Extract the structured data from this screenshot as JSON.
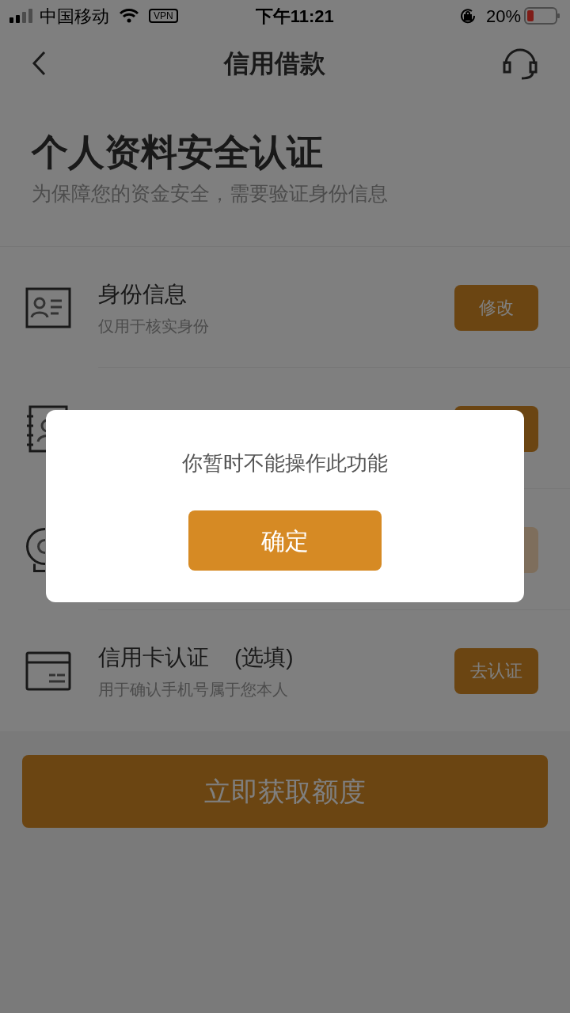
{
  "status_bar": {
    "carrier": "中国移动",
    "vpn": "VPN",
    "time": "下午11:21",
    "battery": "20%"
  },
  "nav": {
    "title": "信用借款"
  },
  "header": {
    "title": "个人资料安全认证",
    "subtitle": "为保障您的资金安全，需要验证身份信息"
  },
  "rows": [
    {
      "title": "身份信息",
      "subtitle": "仅用于核实身份",
      "button": {
        "label": "修改",
        "disabled": false
      }
    },
    {
      "button": {
        "disabled": false
      }
    },
    {
      "button": {
        "disabled": true
      }
    },
    {
      "title": "信用卡认证",
      "tag": "(选填)",
      "subtitle": "用于确认手机号属于您本人",
      "button": {
        "label": "去认证",
        "disabled": false
      }
    }
  ],
  "submit": {
    "label": "立即获取额度"
  },
  "dialog": {
    "message": "你暂时不能操作此功能",
    "button": "确定"
  }
}
